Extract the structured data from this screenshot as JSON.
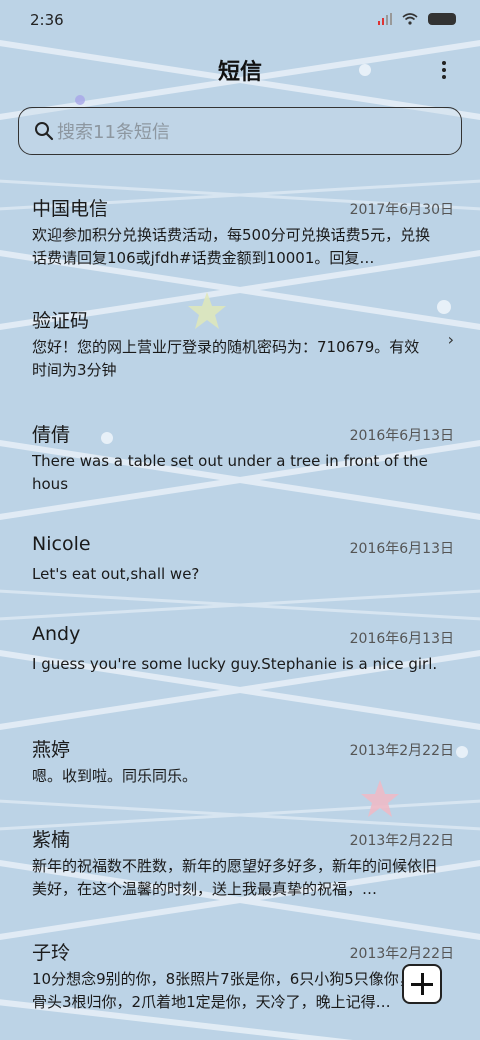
{
  "status": {
    "time": "2:36"
  },
  "header": {
    "title": "短信"
  },
  "search": {
    "placeholder": "搜索11条短信"
  },
  "messages": [
    {
      "name": "中国电信",
      "date": "2017年6月30日",
      "text": "欢迎参加积分兑换话费活动，每500分可兑换话费5元，兑换话费请回复106或jfdh#话费金额到10001。回复…"
    },
    {
      "name": "验证码",
      "date": "",
      "text": "您好！您的网上营业厅登录的随机密码为：710679。有效时间为3分钟"
    },
    {
      "name": "倩倩",
      "date": "2016年6月13日",
      "text": "There was a table set out under a tree in front of the hous"
    },
    {
      "name": "Nicole",
      "date": "2016年6月13日",
      "text": "Let's eat out,shall we?"
    },
    {
      "name": "Andy",
      "date": "2016年6月13日",
      "text": "I guess you're some lucky guy.Stephanie is a nice girl."
    },
    {
      "name": "燕婷",
      "date": "2013年2月22日",
      "text": "嗯。收到啦。同乐同乐。"
    },
    {
      "name": "紫楠",
      "date": "2013年2月22日",
      "text": "新年的祝福数不胜数，新年的愿望好多好多，新年的问候依旧美好，在这个温馨的时刻，送上我最真挚的祝福，…"
    },
    {
      "name": "子玲",
      "date": "2013年2月22日",
      "text": "10分想念9别的你，8张照片7张是你，6只小狗5只像你，4根骨头3根归你，2爪着地1定是你，天冷了，晚上记得…"
    }
  ]
}
